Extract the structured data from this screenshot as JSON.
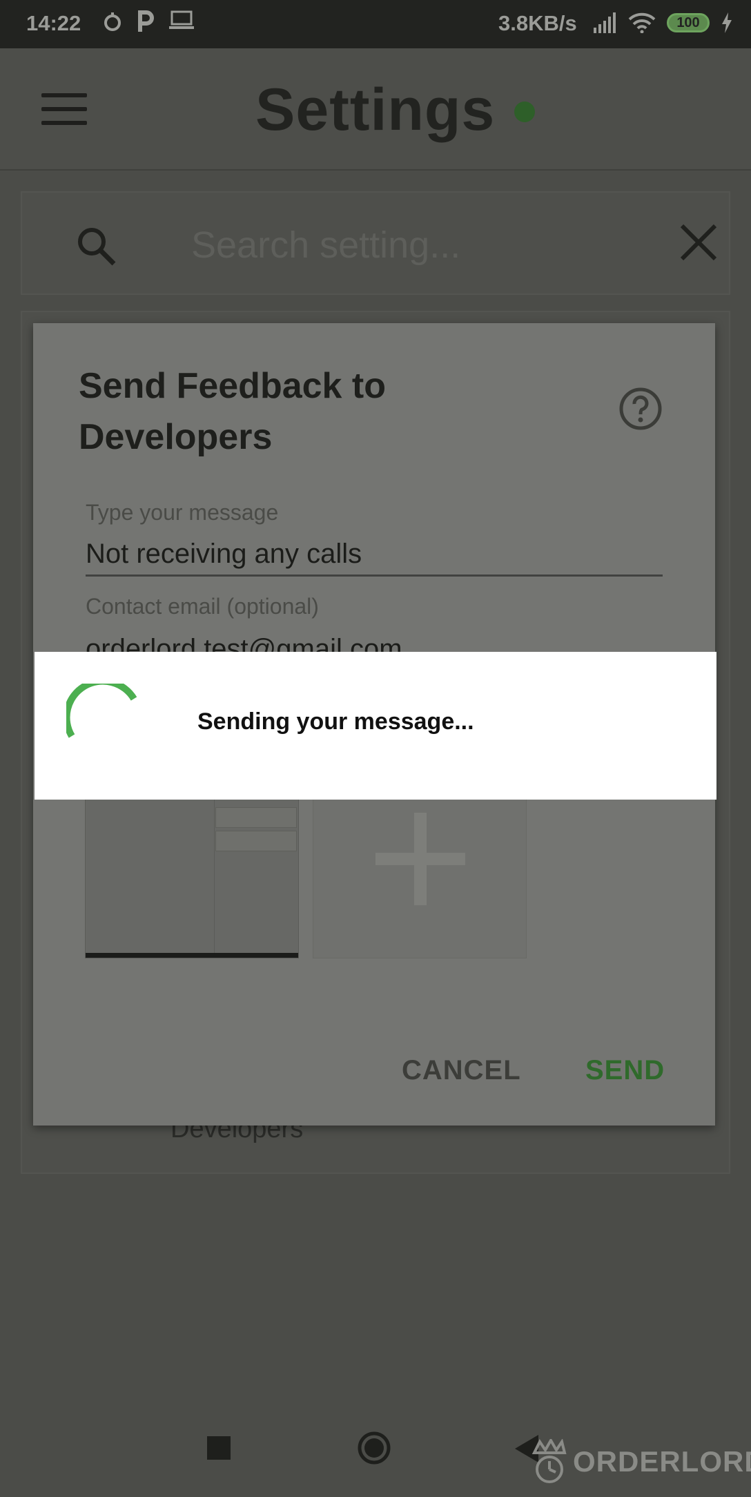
{
  "status_bar": {
    "time": "14:22",
    "network_rate": "3.8KB/s",
    "battery": "100",
    "icons": [
      "alarm-icon",
      "parking-icon",
      "laptop-icon",
      "signal-icon",
      "wifi-icon",
      "battery-icon",
      "charging-icon"
    ]
  },
  "app_bar": {
    "title": "Settings",
    "status_color": "#2e5f29"
  },
  "search": {
    "placeholder": "Search setting..."
  },
  "background": {
    "visible_item": "Developers"
  },
  "dialog": {
    "title": "Send Feedback to Developers",
    "message_label": "Type your message",
    "message_value": "Not receiving any calls",
    "email_label": "Contact email (optional)",
    "email_value": "orderlord.test@gmail.com",
    "cancel_label": "CANCEL",
    "send_label": "SEND",
    "send_color": "#2f6a2b"
  },
  "progress": {
    "text": "Sending your message...",
    "accent": "#4caf50"
  },
  "watermark": {
    "brand": "ORDERLORD"
  }
}
